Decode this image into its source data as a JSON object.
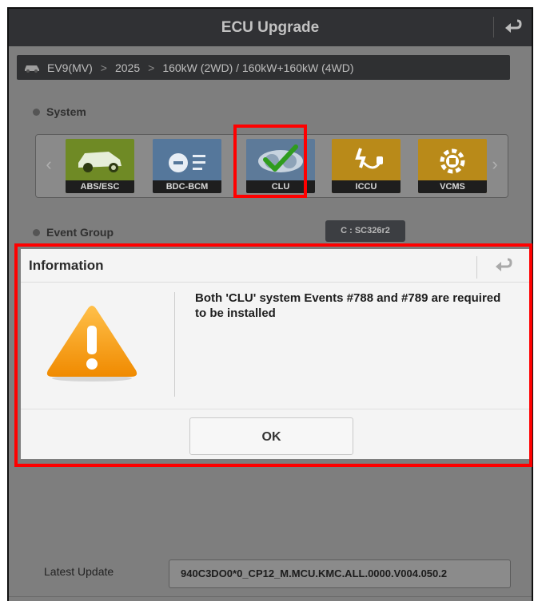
{
  "header": {
    "title": "ECU Upgrade",
    "back_icon": "return-arrow-icon"
  },
  "breadcrumb": {
    "icon": "car-icon",
    "model": "EV9(MV)",
    "year": "2025",
    "engine": "160kW (2WD) / 160kW+160kW (4WD)",
    "separator": ">"
  },
  "system_section": {
    "label": "System",
    "prev_arrow": "‹",
    "next_arrow": "›",
    "tiles": [
      {
        "label": "ABS/ESC",
        "icon": "car-wheel-icon",
        "color": "#6f8a25"
      },
      {
        "label": "BDC-BCM",
        "icon": "bcm-module-icon",
        "color": "#55779b"
      },
      {
        "label": "CLU",
        "icon": "cluster-gauge-check-icon",
        "color": "#5d7a99",
        "selected": true
      },
      {
        "label": "ICCU",
        "icon": "charging-plug-icon",
        "color": "#b98a19"
      },
      {
        "label": "VCMS",
        "icon": "gear-plug-icon",
        "color": "#b98a19"
      }
    ]
  },
  "event_group": {
    "label": "Event Group",
    "version_badge": "C : SC326r2"
  },
  "dialog": {
    "title": "Information",
    "back_icon": "return-arrow-icon",
    "warning_icon": "warning-triangle-icon",
    "message": "Both 'CLU' system Events #788 and #789 are required to be installed",
    "ok_label": "OK"
  },
  "latest_update": {
    "label": "Latest Update",
    "value": "940C3DO0*0_CP12_M.MCU.KMC.ALL.0000.V004.050.2"
  },
  "colors": {
    "highlight": "#ff0000",
    "titlebar": "#303134",
    "overlay": "#7e7e7e",
    "warning": "#f5a623"
  }
}
